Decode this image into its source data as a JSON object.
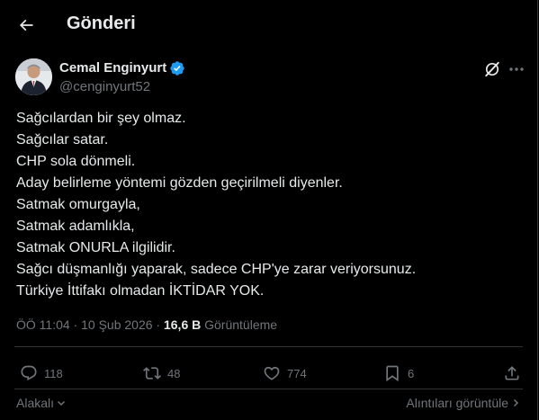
{
  "header": {
    "title": "Gönderi"
  },
  "author": {
    "name": "Cemal Enginyurt",
    "handle": "@cenginyurt52"
  },
  "tweet": {
    "lines": [
      "Sağcılardan bir şey olmaz.",
      "Sağcılar satar.",
      "CHP sola dönmeli.",
      "Aday belirleme yöntemi gözden geçirilmeli diyenler.",
      "Satmak omurgayla,",
      "Satmak adamlıkla,",
      "Satmak ONURLA ilgilidir.",
      "Sağcı düşmanlığı yaparak, sadece CHP'ye zarar veriyorsunuz.",
      "Türkiye İttifakı olmadan İKTİDAR YOK."
    ]
  },
  "meta": {
    "time": "ÖÖ 11:04",
    "separator": " · ",
    "date": "10 Şub 2026",
    "views_count": "16,6 B",
    "views_label": "Görüntüleme"
  },
  "actions": {
    "replies": "118",
    "reposts": "48",
    "likes": "774",
    "bookmarks": "6"
  },
  "footer": {
    "related": "Alakalı",
    "quotes": "Alıntıları görüntüle"
  },
  "colors": {
    "background": "#000000",
    "text": "#e7e9ea",
    "muted": "#71767b",
    "divider": "#2f3336",
    "verified": "#1d9bf0"
  }
}
